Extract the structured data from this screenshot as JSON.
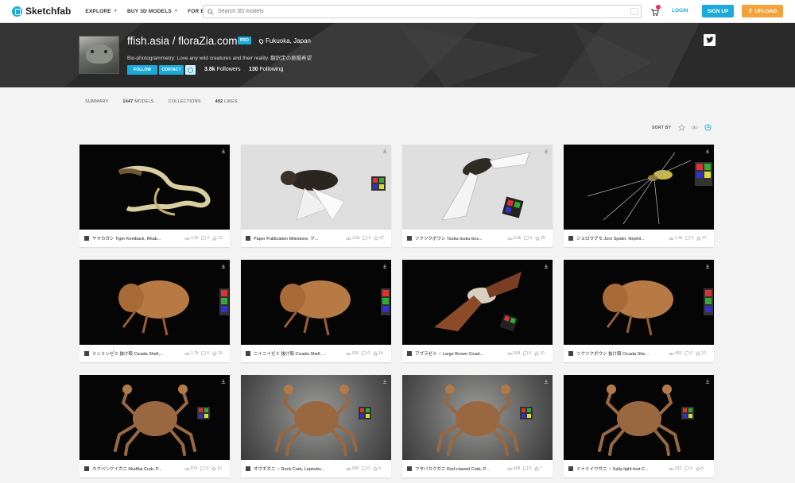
{
  "nav": {
    "logo": "Sketchfab",
    "links": [
      "EXPLORE",
      "BUY 3D MODELS",
      "FOR BUSINESS"
    ],
    "search_placeholder": "Search 3D models",
    "login": "LOGIN",
    "signup": "SIGN UP",
    "upload": "UPLOAD"
  },
  "profile": {
    "name": "ffish.asia / floraZia.com",
    "badge": "PRO",
    "location": "Fukuoka, Japan",
    "bio": "Bio-photogrammetry: Love any wild creatures and their reality. 翻訳定の振擬希望",
    "follow_label": "FOLLOW",
    "contact_label": "CONTACT",
    "followers_count": "3.8k",
    "followers_label": "Followers",
    "following_count": "130",
    "following_label": "Following"
  },
  "tabs": [
    {
      "count": "",
      "label": "SUMMARY"
    },
    {
      "count": "1447",
      "label": "MODELS"
    },
    {
      "count": "",
      "label": "COLLECTIONS"
    },
    {
      "count": "492",
      "label": "LIKES"
    }
  ],
  "sort_label": "SORT BY",
  "colors": {
    "accent": "#1caad9",
    "upload": "#f4a23c",
    "header_bg": "#2f2f2f"
  },
  "models": [
    {
      "title": "ヤマカガシ Tiger Keelback, Rhab...",
      "views": "2.2k",
      "comments": "2",
      "likes": "13",
      "bg": "dark",
      "subject": "snake-icon"
    },
    {
      "title": "Paper Publication Milestone, ク...",
      "views": "3.6k",
      "comments": "4",
      "likes": "37",
      "bg": "light",
      "subject": "cicada-icon"
    },
    {
      "title": "ツクツクボウシ Tsuku-tsuku-bos...",
      "views": "3.4k",
      "comments": "0",
      "likes": "25",
      "bg": "light",
      "subject": "cicada-wings-icon"
    },
    {
      "title": "ジョロウグモ Joro Spider, Nephil...",
      "views": "1.4k",
      "comments": "0",
      "likes": "27",
      "bg": "dark",
      "subject": "spider-icon"
    },
    {
      "title": "ミンミンゼミ 抜け殻 Cicada Shell,...",
      "views": "1.7k",
      "comments": "0",
      "likes": "18",
      "bg": "dark",
      "subject": "cicada-shell-icon"
    },
    {
      "title": "ニイニイゼミ 抜け殻 Cicada Shell, ...",
      "views": "600",
      "comments": "0",
      "likes": "14",
      "bg": "dark",
      "subject": "cicada-shell-icon"
    },
    {
      "title": "アブラゼミ ♂ Large Brown Cicad...",
      "views": "654",
      "comments": "0",
      "likes": "10",
      "bg": "dark",
      "subject": "moth-icon"
    },
    {
      "title": "ツクツクボウシ 抜け殻 Cicada She...",
      "views": "433",
      "comments": "0",
      "likes": "10",
      "bg": "dark",
      "subject": "cicada-shell-icon"
    },
    {
      "title": "カクベンケイガニ Mudflat Crab, P...",
      "views": "874",
      "comments": "0",
      "likes": "10",
      "bg": "dark",
      "subject": "crab-icon"
    },
    {
      "title": "オウギガニ ♂ Rock Crab, Leptodiu...",
      "views": "590",
      "comments": "0",
      "likes": "9",
      "bg": "gray",
      "subject": "crab-icon"
    },
    {
      "title": "フタバカクガニ Red-clawed Crab, P...",
      "views": "408",
      "comments": "0",
      "likes": "7",
      "bg": "gray",
      "subject": "crab-icon"
    },
    {
      "title": "ミナミイワガニ ♂ Sally-light-foot C...",
      "views": "532",
      "comments": "0",
      "likes": "6",
      "bg": "dark",
      "subject": "crab-icon"
    }
  ]
}
